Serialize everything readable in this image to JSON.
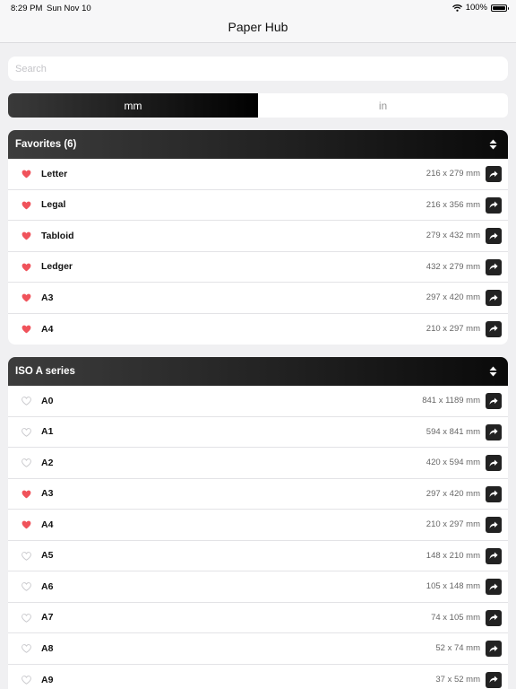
{
  "status": {
    "time": "8:29 PM",
    "date": "Sun Nov 10",
    "battery": "100%"
  },
  "nav": {
    "title": "Paper Hub"
  },
  "search": {
    "placeholder": "Search"
  },
  "units": {
    "options": [
      "mm",
      "in"
    ],
    "selected": "mm"
  },
  "sections": [
    {
      "title": "Favorites (6)",
      "items": [
        {
          "name": "Letter",
          "size": "216 x 279 mm",
          "favorite": true
        },
        {
          "name": "Legal",
          "size": "216 x 356 mm",
          "favorite": true
        },
        {
          "name": "Tabloid",
          "size": "279 x 432 mm",
          "favorite": true
        },
        {
          "name": "Ledger",
          "size": "432 x 279 mm",
          "favorite": true
        },
        {
          "name": "A3",
          "size": "297 x 420 mm",
          "favorite": true
        },
        {
          "name": "A4",
          "size": "210 x 297 mm",
          "favorite": true
        }
      ]
    },
    {
      "title": "ISO A series",
      "items": [
        {
          "name": "A0",
          "size": "841 x 1189 mm",
          "favorite": false
        },
        {
          "name": "A1",
          "size": "594 x 841 mm",
          "favorite": false
        },
        {
          "name": "A2",
          "size": "420 x 594 mm",
          "favorite": false
        },
        {
          "name": "A3",
          "size": "297 x 420 mm",
          "favorite": true
        },
        {
          "name": "A4",
          "size": "210 x 297 mm",
          "favorite": true
        },
        {
          "name": "A5",
          "size": "148 x 210 mm",
          "favorite": false
        },
        {
          "name": "A6",
          "size": "105 x 148 mm",
          "favorite": false
        },
        {
          "name": "A7",
          "size": "74 x 105 mm",
          "favorite": false
        },
        {
          "name": "A8",
          "size": "52 x 74 mm",
          "favorite": false
        },
        {
          "name": "A9",
          "size": "37 x 52 mm",
          "favorite": false
        }
      ]
    }
  ],
  "colors": {
    "heart": "#f0535b",
    "heart_outline": "#c8c8cc",
    "header_dark": "#0a0a0a"
  },
  "icons": {
    "favorite": "heart-icon",
    "share": "share-icon",
    "sort": "sort-icon",
    "wifi": "wifi-icon",
    "battery": "battery-icon"
  }
}
